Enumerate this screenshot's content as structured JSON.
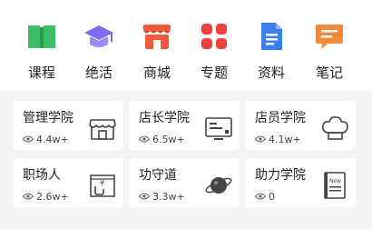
{
  "nav": [
    {
      "label": "课程",
      "icon": "book-icon",
      "color": "#3dbf6a"
    },
    {
      "label": "绝活",
      "icon": "graduation-cap-icon",
      "color": "#7b6cf0"
    },
    {
      "label": "商城",
      "icon": "store-icon",
      "color": "#f05a3a"
    },
    {
      "label": "专题",
      "icon": "grid-icon",
      "color": "#f04040"
    },
    {
      "label": "资料",
      "icon": "document-icon",
      "color": "#3a7ff0"
    },
    {
      "label": "笔记",
      "icon": "chat-note-icon",
      "color": "#f08a3a"
    }
  ],
  "cards": [
    {
      "title": "管理学院",
      "views": "4.4w+",
      "icon": "shop-icon"
    },
    {
      "title": "店长学院",
      "views": "6.5w+",
      "icon": "screen-icon"
    },
    {
      "title": "店员学院",
      "views": "4.1w+",
      "icon": "chef-hat-icon"
    },
    {
      "title": "职场人",
      "views": "2.6w+",
      "icon": "wallet-icon"
    },
    {
      "title": "功守道",
      "views": "3.3w+",
      "icon": "planet-icon"
    },
    {
      "title": "助力学院",
      "views": "0",
      "icon": "new-book-icon"
    }
  ],
  "new_badge": "New"
}
